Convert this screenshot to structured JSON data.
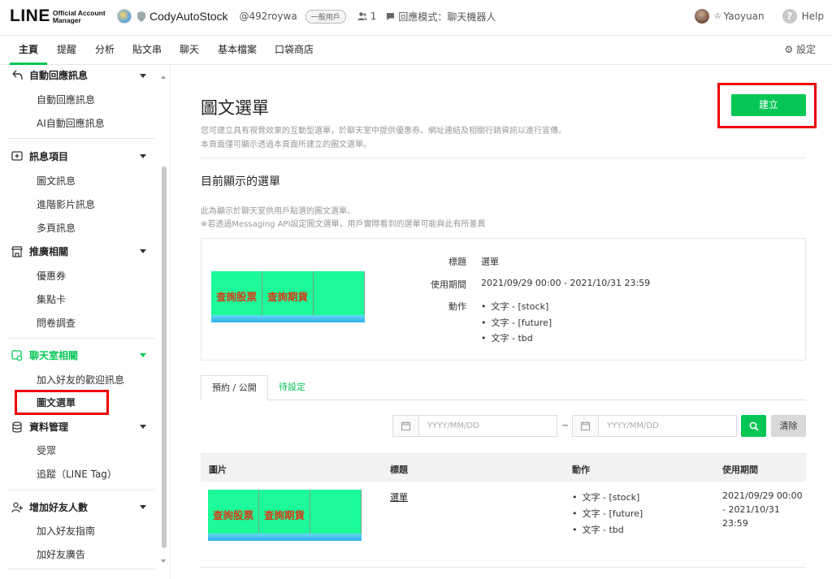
{
  "header": {
    "logo_main": "LINE",
    "logo_sub_1": "Official Account",
    "logo_sub_2": "Manager",
    "account_name": "CodyAutoStock",
    "account_id": "@492roywa",
    "account_tag": "一般用戶",
    "friends_count": "1",
    "reply_mode": "回應模式：聊天機器人",
    "username": "Yaoyuan",
    "help": "Help"
  },
  "nav": {
    "tabs": [
      "主頁",
      "提醒",
      "分析",
      "貼文串",
      "聊天",
      "基本檔案",
      "口袋商店"
    ],
    "active": "主頁",
    "settings": "設定"
  },
  "sidebar": {
    "sections": [
      {
        "label": "自動回應訊息",
        "items": [
          "自動回應訊息",
          "AI自動回應訊息"
        ]
      },
      {
        "label": "訊息項目",
        "items": [
          "圖文訊息",
          "進階影片訊息",
          "多頁訊息"
        ]
      },
      {
        "label": "推廣相關",
        "items": [
          "優惠券",
          "集點卡",
          "問卷調查"
        ]
      },
      {
        "label": "聊天室相關",
        "items": [
          "加入好友的歡迎訊息",
          "圖文選單"
        ]
      },
      {
        "label": "資料管理",
        "items": [
          "受眾",
          "追蹤（LINE Tag）"
        ]
      },
      {
        "label": "增加好友人數",
        "items": [
          "加入好友指南",
          "加好友廣告"
        ]
      }
    ]
  },
  "main": {
    "title": "圖文選單",
    "desc_1": "您可建立具有視覺效果的互動型選單，於聊天室中提供優惠券、網址連結及相關行銷資訊以進行宣傳。",
    "desc_2": "本頁面僅可顯示透過本頁面所建立的圖文選單。",
    "create_button": "建立",
    "current_heading": "目前顯示的選單",
    "current_desc_1": "此為顯示於聊天室供用戶點選的圖文選單。",
    "current_desc_2": "※若透過Messaging API設定圖文選單，用戶實際看到的選單可能與此有所差異",
    "menu_cells": [
      "查詢股票",
      "查詢期貨",
      ""
    ],
    "meta": {
      "title_label": "標題",
      "title_value": "選單",
      "period_label": "使用期間",
      "period_value": "2021/09/29 00:00 - 2021/10/31 23:59",
      "action_label": "動作",
      "actions": [
        "文字 - [stock]",
        "文字 - [future]",
        "文字 - tbd"
      ]
    },
    "tabs": [
      "預約 / 公開",
      "待設定"
    ],
    "date_placeholder_start": "YYYY/MM/DD",
    "date_placeholder_end": "YYYY/MM/DD",
    "tilde": "~",
    "clear_button": "清除",
    "table": {
      "headers": [
        "圖片",
        "標題",
        "動作",
        "使用期間"
      ],
      "rows": [
        {
          "title": "選單",
          "actions": [
            "文字 - [stock]",
            "文字 - [future]",
            "文字 - tbd"
          ],
          "period_1": "2021/09/29 00:00",
          "period_2": "- 2021/10/31",
          "period_3": "23:59"
        }
      ]
    }
  },
  "colors": {
    "accent": "#06c755",
    "highlight": "#ee0000",
    "menu_bg": "#1dfa99",
    "menu_text": "#d63b16"
  }
}
